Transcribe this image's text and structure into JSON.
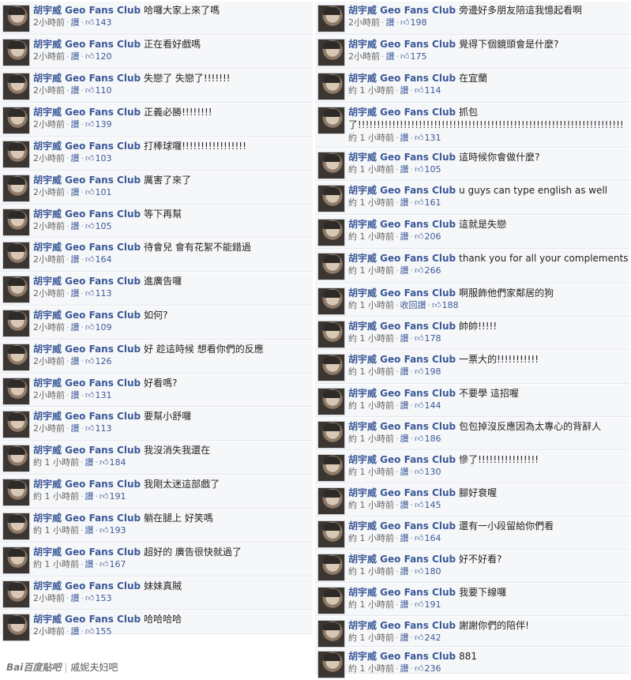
{
  "author": "胡宇威 Geo Fans Club",
  "like_label": "讚",
  "unlike_label": "收回讚",
  "left_posts": [
    {
      "msg": "哈囉大家上來了嗎",
      "time": "2小時前",
      "like": "讚",
      "likes": "143"
    },
    {
      "msg": "正在看好戲嗎",
      "time": "2小時前",
      "like": "讚",
      "likes": "120"
    },
    {
      "msg": "失戀了 失戀了!!!!!!!",
      "time": "2小時前",
      "like": "讚",
      "likes": "110"
    },
    {
      "msg": "正義必勝!!!!!!!!",
      "time": "2小時前",
      "like": "讚",
      "likes": "139"
    },
    {
      "msg": "打棒球囉!!!!!!!!!!!!!!!!!",
      "time": "2小時前",
      "like": "讚",
      "likes": "103"
    },
    {
      "msg": "厲害了來了",
      "time": "2小時前",
      "like": "讚",
      "likes": "101"
    },
    {
      "msg": "等下再幫",
      "time": "2小時前",
      "like": "讚",
      "likes": "105"
    },
    {
      "msg": "待會兒 會有花絮不能錯過",
      "time": "2小時前",
      "like": "讚",
      "likes": "164"
    },
    {
      "msg": "進廣告囉",
      "time": "2小時前",
      "like": "讚",
      "likes": "113"
    },
    {
      "msg": "如何?",
      "time": "2小時前",
      "like": "讚",
      "likes": "109"
    },
    {
      "msg": "好 趁這時候 想看你們的反應",
      "time": "2小時前",
      "like": "讚",
      "likes": "126"
    },
    {
      "msg": "好看嗎?",
      "time": "2小時前",
      "like": "讚",
      "likes": "131"
    },
    {
      "msg": "要幫小舒囉",
      "time": "2小時前",
      "like": "讚",
      "likes": "113"
    },
    {
      "msg": "我沒消失我還在",
      "time": "約 1 小時前",
      "like": "讚",
      "likes": "184"
    },
    {
      "msg": "我剛太迷這部戲了",
      "time": "約 1 小時前",
      "like": "讚",
      "likes": "191"
    },
    {
      "msg": "躺在腿上 好笑嗎",
      "time": "約 1 小時前",
      "like": "讚",
      "likes": "193"
    },
    {
      "msg": "超好的 廣告很快就過了",
      "time": "約 1 小時前",
      "like": "讚",
      "likes": "167"
    },
    {
      "msg": "妹妹真賊",
      "time": "2小時前",
      "like": "讚",
      "likes": "153"
    },
    {
      "msg": "哈哈哈哈",
      "time": "2小時前",
      "like": "讚",
      "likes": "155"
    }
  ],
  "right_posts": [
    {
      "msg": "旁邊好多朋友陪這我憶起看啊",
      "time": "2小時前",
      "like": "讚",
      "likes": "198"
    },
    {
      "msg": "覺得下個鏡頭會是什麼?",
      "time": "2小時前",
      "like": "讚",
      "likes": "175"
    },
    {
      "msg": "在宜蘭",
      "time": "約 1 小時前",
      "like": "讚",
      "likes": "114"
    },
    {
      "msg": "抓包",
      "msg2": "了!!!!!!!!!!!!!!!!!!!!!!!!!!!!!!!!!!!!!!!!!!!!!!!!!!!!!!!!!!!!!!!!!!!!!!",
      "time": "約 1 小時前",
      "like": "讚",
      "likes": "131"
    },
    {
      "msg": "這時候你會做什麼?",
      "time": "約 1 小時前",
      "like": "讚",
      "likes": "105"
    },
    {
      "msg": "u guys can type english as well",
      "time": "約 1 小時前",
      "like": "讚",
      "likes": "161"
    },
    {
      "msg": "這就是失戀",
      "time": "約 1 小時前",
      "like": "讚",
      "likes": "206"
    },
    {
      "msg": "thank you for all your complements",
      "time": "約 1 小時前",
      "like": "讚",
      "likes": "266"
    },
    {
      "msg": "啊服飾他們家鄰居的狗",
      "time": "約 1 小時前",
      "like": "收回讚",
      "likes": "188"
    },
    {
      "msg": "帥帥!!!!!",
      "time": "約 1 小時前",
      "like": "讚",
      "likes": "178"
    },
    {
      "msg": "一票大的!!!!!!!!!!!",
      "time": "約 1 小時前",
      "like": "讚",
      "likes": "198"
    },
    {
      "msg": "不要學 這招喔",
      "time": "約 1 小時前",
      "like": "讚",
      "likes": "144"
    },
    {
      "msg": "包包掉沒反應因為太專心的背辭人",
      "time": "約 1 小時前",
      "like": "讚",
      "likes": "186"
    },
    {
      "msg": "慘了!!!!!!!!!!!!!!!!",
      "time": "約 1 小時前",
      "like": "讚",
      "likes": "130"
    },
    {
      "msg": "腳好衰喔",
      "time": "約 1 小時前",
      "like": "讚",
      "likes": "145"
    },
    {
      "msg": "還有一小段留給你們看",
      "time": "約 1 小時前",
      "like": "讚",
      "likes": "164"
    },
    {
      "msg": "好不好看?",
      "time": "約 1 小時前",
      "like": "讚",
      "likes": "180"
    },
    {
      "msg": "我要下線囉",
      "time": "約 1 小時前",
      "like": "讚",
      "likes": "191"
    },
    {
      "msg": "謝謝你們的陪伴!",
      "time": "約 1 小時前",
      "like": "讚",
      "likes": "242"
    },
    {
      "msg": "881",
      "time": "約 1 小時前",
      "like": "讚",
      "likes": "236"
    }
  ],
  "watermark": {
    "logo": "Bai百度贴吧",
    "text": "戚妮夫妇吧"
  },
  "colors": {
    "author": "#3b5998",
    "post_bg": "#f6f7f9"
  }
}
